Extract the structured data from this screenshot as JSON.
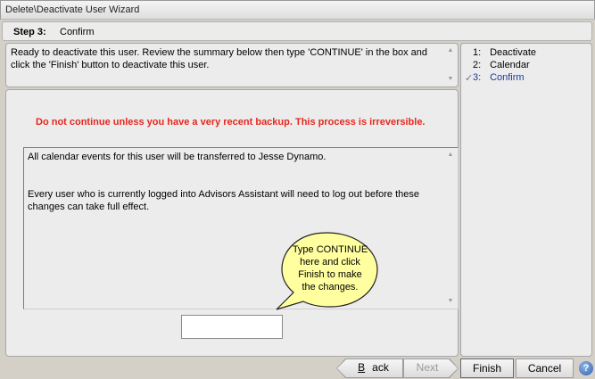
{
  "window": {
    "title": "Delete\\Deactivate User Wizard"
  },
  "step_header": {
    "step_label": "Step 3:",
    "step_name": "Confirm"
  },
  "instructions": "Ready to deactivate this user.  Review the summary below then type 'CONTINUE' in the box and click the 'Finish' button to deactivate this user.",
  "steps": [
    {
      "number": "1:",
      "label": "Deactivate",
      "current": false
    },
    {
      "number": "2:",
      "label": "Calendar",
      "current": false
    },
    {
      "number": "3:",
      "label": "Confirm",
      "current": true
    }
  ],
  "main": {
    "warning": "Do not continue unless you have a very recent backup.  This process is irreversible.",
    "warning_color": "#e8261b",
    "summary_lines": [
      "All calendar events for this user will be transferred to Jesse Dynamo.",
      "Every user who is currently logged into Advisors Assistant will need to log out before these changes can take full effect."
    ],
    "continue_input": {
      "value": "",
      "placeholder": ""
    }
  },
  "callout": {
    "lines": [
      "Type CONTINUE",
      "here and click",
      "Finish to make",
      "the changes."
    ],
    "fill_color": "#ffffa0"
  },
  "buttons": {
    "back_prefix": "",
    "back_accel": "B",
    "back_rest": "ack",
    "next": "Next",
    "finish": "Finish",
    "cancel": "Cancel",
    "help_glyph": "?"
  }
}
